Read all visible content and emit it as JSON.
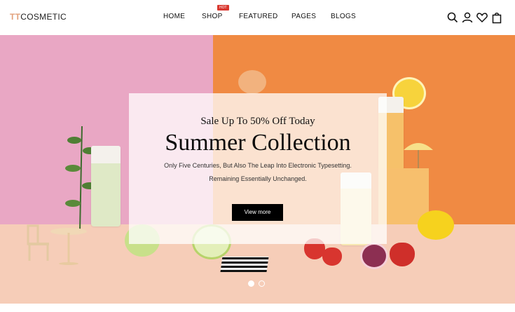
{
  "brand": {
    "logo_accent": "TT",
    "logo_rest": "COSMETIC"
  },
  "nav": {
    "items": [
      {
        "label": "HOME"
      },
      {
        "label": "SHOP",
        "badge": "HOT"
      },
      {
        "label": "FEATURED"
      },
      {
        "label": "PAGES"
      },
      {
        "label": "BLOGS"
      }
    ]
  },
  "header_icons": [
    "search-icon",
    "user-icon",
    "heart-icon",
    "shopping-bag-icon"
  ],
  "hero": {
    "sale_text": "Sale Up To 50% Off Today",
    "title": "Summer Collection",
    "description_line1": "Only Five Centuries, But Also The Leap Into Electronic Typesetting.",
    "description_line2": "Remaining Essentially Unchanged.",
    "cta_label": "View more",
    "slide_count": 2,
    "active_slide": 1
  },
  "colors": {
    "accent_logo": "#e2a07a",
    "hot_badge": "#d9372e",
    "bg_pink": "#e9a7c4",
    "bg_orange": "#f08a43",
    "floor": "#f6cdb8",
    "button": "#000000"
  }
}
